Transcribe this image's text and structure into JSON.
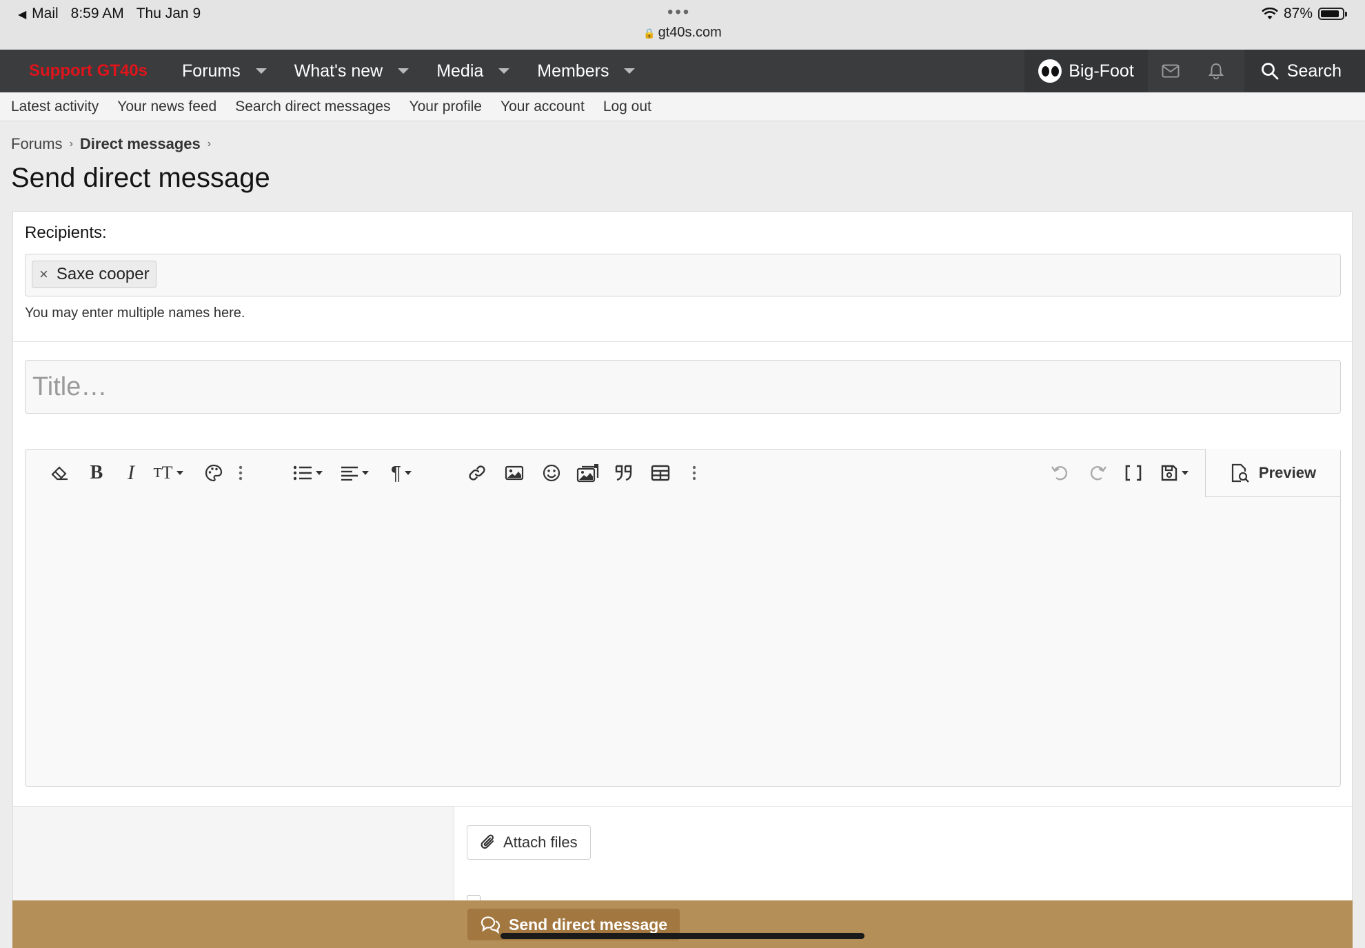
{
  "status_bar": {
    "back_app": "Mail",
    "time": "8:59 AM",
    "date": "Thu Jan 9",
    "url": "gt40s.com",
    "battery": "87%",
    "battery_level": 0.87
  },
  "navbar": {
    "support_label": "Support GT40s",
    "items": [
      {
        "label": "Forums"
      },
      {
        "label": "What's new"
      },
      {
        "label": "Media"
      },
      {
        "label": "Members"
      }
    ],
    "username": "Big-Foot",
    "search_label": "Search",
    "support_color": "#e0141b",
    "bar_color": "#3a3c3e"
  },
  "subnav": {
    "items": [
      "Latest activity",
      "Your news feed",
      "Search direct messages",
      "Your profile",
      "Your account",
      "Log out"
    ]
  },
  "breadcrumb": [
    "Forums",
    "Direct messages"
  ],
  "page_title": "Send direct message",
  "form": {
    "recipients_label": "Recipients:",
    "recipient_token": "Saxe cooper",
    "token_remove": "×",
    "hint": "You may enter multiple names here.",
    "title_placeholder": "Title…",
    "title_value": "",
    "preview_label": "Preview",
    "attach_label": "Attach files",
    "send_label": "Send direct message",
    "send_bar_color": "#b58f58"
  },
  "toolbar_icons": [
    "eraser-icon",
    "bold-icon",
    "italic-icon",
    "text-size-icon",
    "palette-icon",
    "more-icon",
    "list-icon",
    "align-icon",
    "paragraph-icon",
    "link-icon",
    "image-icon",
    "smile-icon",
    "media-icon",
    "quote-icon",
    "table-icon",
    "more-icon",
    "undo-icon",
    "redo-icon",
    "bbcode-icon",
    "drafts-icon"
  ]
}
